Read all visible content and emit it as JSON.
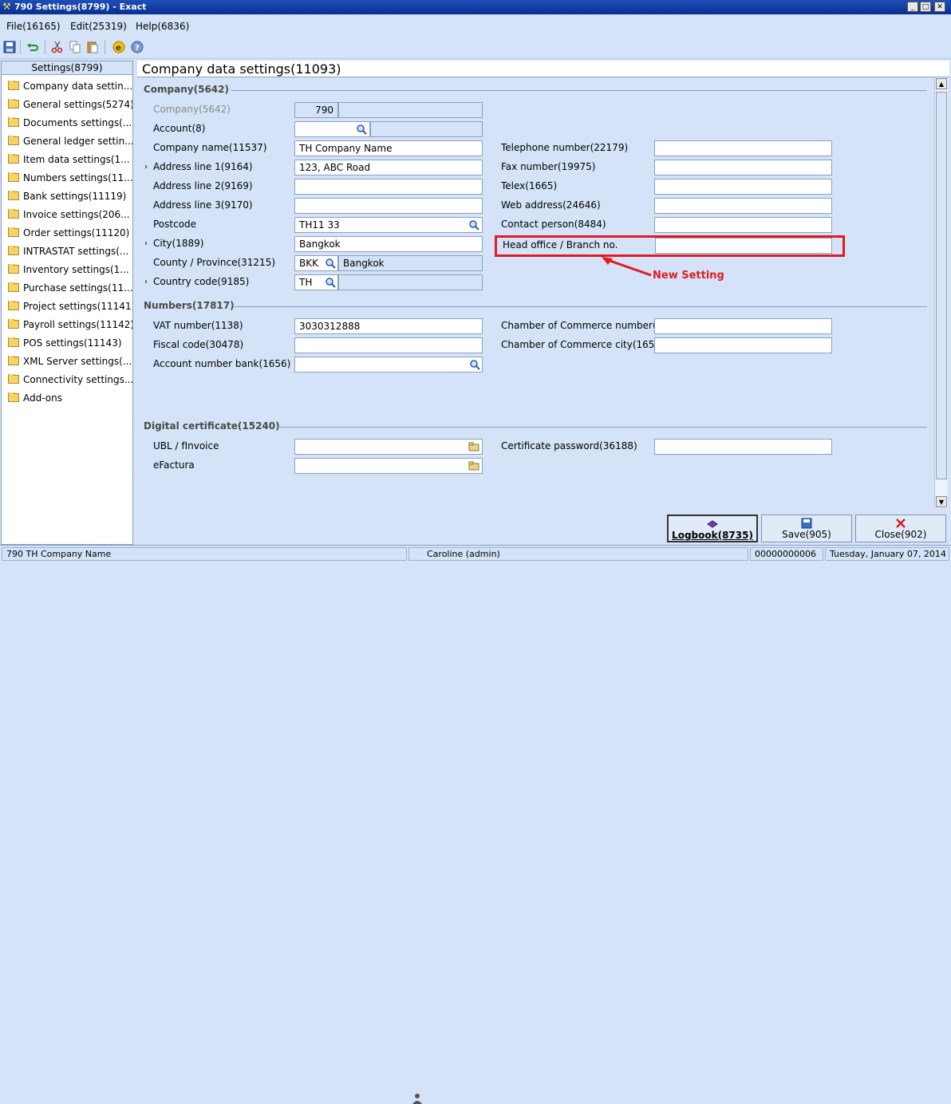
{
  "window": {
    "title": "790 Settings(8799) - Exact"
  },
  "menu": [
    "File(16165)",
    "Edit(25319)",
    "Help(6836)"
  ],
  "sidebar": {
    "header": "Settings(8799)",
    "items": [
      "Company data settin...",
      "General settings(5274)",
      "Documents settings(...",
      "General ledger settin...",
      "Item data settings(1...",
      "Numbers settings(11...",
      "Bank settings(11119)",
      "Invoice settings(206...",
      "Order settings(11120)",
      "INTRASTAT settings(...",
      "Inventory settings(1...",
      "Purchase settings(11...",
      "Project settings(11141)",
      "Payroll settings(11142)",
      "POS settings(11143)",
      "XML Server settings(...",
      "Connectivity settings...",
      "Add-ons"
    ]
  },
  "page": {
    "title": "Company data settings(11093)"
  },
  "company": {
    "section": "Company(5642)",
    "company_label": "Company(5642)",
    "company_code": "790",
    "company_name_ro": "",
    "account_label": "Account(8)",
    "account_value": "",
    "account_desc": "",
    "name_label": "Company name(11537)",
    "name_value": "TH Company Name",
    "addr1_label": "Address line 1(9164)",
    "addr1_value": "123, ABC Road",
    "addr2_label": "Address line 2(9169)",
    "addr2_value": "",
    "addr3_label": "Address line 3(9170)",
    "addr3_value": "",
    "postcode_label": "Postcode",
    "postcode_value": "TH11 33",
    "city_label": "City(1889)",
    "city_value": "Bangkok",
    "county_label": "County / Province(31215)",
    "county_code": "BKK",
    "county_name": "Bangkok",
    "country_label": "Country code(9185)",
    "country_code": "TH",
    "country_name": "",
    "tel_label": "Telephone number(22179)",
    "tel_value": "",
    "fax_label": "Fax number(19975)",
    "fax_value": "",
    "telex_label": "Telex(1665)",
    "telex_value": "",
    "web_label": "Web address(24646)",
    "web_value": "",
    "contact_label": "Contact person(8484)",
    "contact_value": "",
    "branch_label": "Head office / Branch no.",
    "branch_value": ""
  },
  "numbers": {
    "section": "Numbers(17817)",
    "vat_label": "VAT number(1138)",
    "vat_value": "3030312888",
    "fiscal_label": "Fiscal code(30478)",
    "fiscal_value": "",
    "bank_label": "Account number bank(1656)",
    "bank_value": "",
    "coc_label": "Chamber of Commerce number(1",
    "coc_value": "",
    "coccity_label": "Chamber of Commerce city(1658",
    "coccity_value": ""
  },
  "certificate": {
    "section": "Digital certificate(15240)",
    "ubl_label": "UBL / fInvoice",
    "ubl_value": "",
    "efactura_label": "eFactura",
    "efactura_value": "",
    "password_label": "Certificate password(36188)",
    "password_value": ""
  },
  "annotation": {
    "text": "New Setting"
  },
  "buttons": {
    "logbook": "Logbook(8735)",
    "save": "Save(905)",
    "close": "Close(902)"
  },
  "status": {
    "company": "790 TH Company Name",
    "user": "Caroline (admin)",
    "number": "00000000006",
    "date": "Tuesday, January 07, 2014"
  },
  "colors": {
    "background": "#d4e3f7",
    "annotation": "#e01b24",
    "titlebar": "#0a2f8f"
  }
}
